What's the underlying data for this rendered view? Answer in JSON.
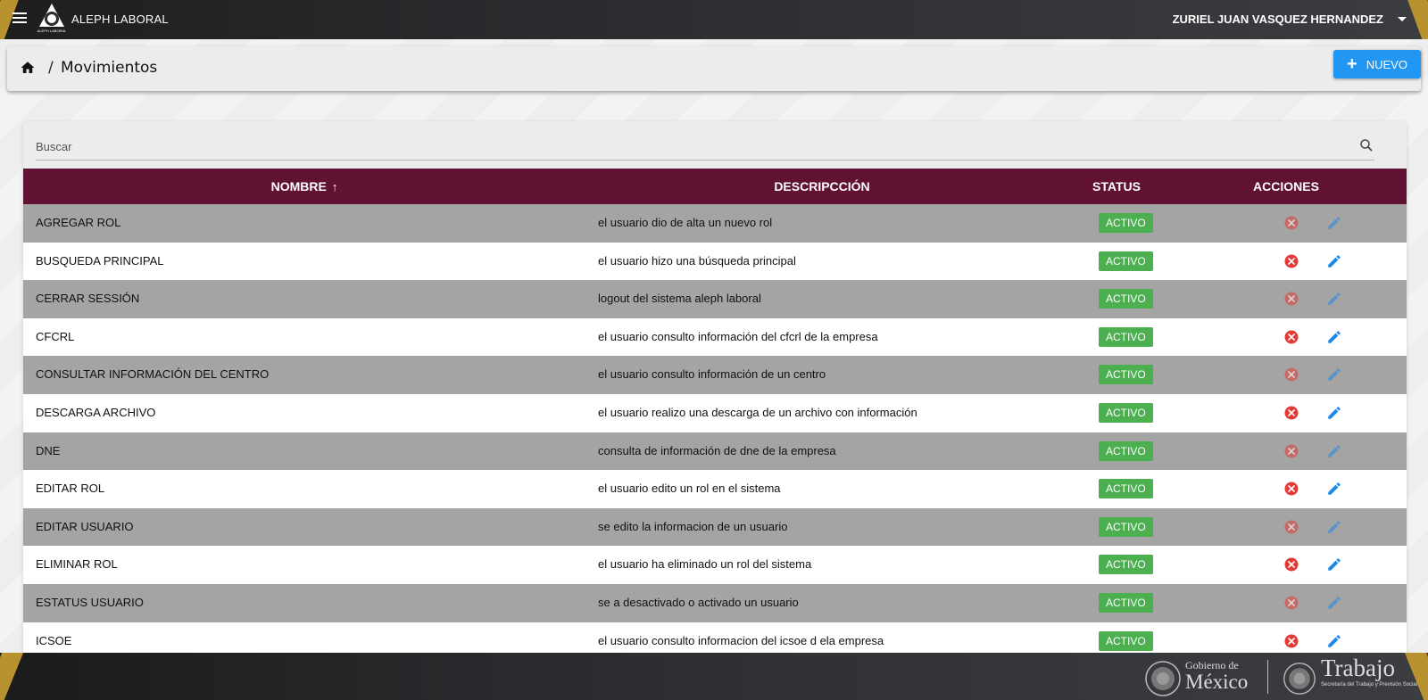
{
  "topbar": {
    "app_name": "ALEPH LABORAL",
    "logo_caption": "ALEPH LABORAL",
    "user_name": "ZURIEL JUAN VASQUEZ HERNANDEZ"
  },
  "breadcrumb": {
    "separator": "/",
    "title": "Movimientos",
    "new_button_label": "NUEVO"
  },
  "search": {
    "placeholder": "Buscar"
  },
  "table": {
    "headers": {
      "nombre": "NOMBRE",
      "sort_indicator": "↑",
      "descripcion": "DESCRIPCCIÓN",
      "status": "STATUS",
      "acciones": "ACCIONES"
    },
    "rows": [
      {
        "nombre": "AGREGAR ROL",
        "descripcion": "el usuario dio de alta un nuevo rol",
        "status": "ACTIVO"
      },
      {
        "nombre": "BUSQUEDA PRINCIPAL",
        "descripcion": "el usuario hizo una búsqueda principal",
        "status": "ACTIVO"
      },
      {
        "nombre": "CERRAR SESSIÓN",
        "descripcion": "logout del sistema aleph laboral",
        "status": "ACTIVO"
      },
      {
        "nombre": "CFCRL",
        "descripcion": "el usuario consulto información del cfcrl de la empresa",
        "status": "ACTIVO"
      },
      {
        "nombre": "CONSULTAR INFORMACIÓN DEL CENTRO",
        "descripcion": "el usuario consulto información de un centro",
        "status": "ACTIVO"
      },
      {
        "nombre": "DESCARGA ARCHIVO",
        "descripcion": "el usuario realizo una descarga de un archivo con información",
        "status": "ACTIVO"
      },
      {
        "nombre": "DNE",
        "descripcion": "consulta de información de dne de la empresa",
        "status": "ACTIVO"
      },
      {
        "nombre": "EDITAR ROL",
        "descripcion": "el usuario edito un rol en el sistema",
        "status": "ACTIVO"
      },
      {
        "nombre": "EDITAR USUARIO",
        "descripcion": "se edito la informacion de un usuario",
        "status": "ACTIVO"
      },
      {
        "nombre": "ELIMINAR ROL",
        "descripcion": "el usuario ha eliminado un rol del sistema",
        "status": "ACTIVO"
      },
      {
        "nombre": "ESTATUS USUARIO",
        "descripcion": "se a desactivado o activado un usuario",
        "status": "ACTIVO"
      },
      {
        "nombre": "ICSOE",
        "descripcion": "el usuario consulto informacion del icsoe d ela empresa",
        "status": "ACTIVO"
      }
    ]
  },
  "footer": {
    "gobierno_line1": "Gobierno de",
    "gobierno_line2": "México",
    "trabajo_line1": "Trabajo",
    "trabajo_line2": "Secretaría del Trabajo y Previsión Social"
  },
  "icons": {
    "menu": "menu-icon",
    "home": "home-icon",
    "add": "plus-icon",
    "search": "search-icon",
    "delete": "cancel-circle-icon",
    "edit": "pencil-icon",
    "user_caret": "caret-down-icon"
  },
  "colors": {
    "header_maroon": "#611232",
    "status_green": "#4caf50",
    "primary_blue": "#2196f3",
    "delete_red": "#e53935",
    "gold_accent": "#b8922e"
  }
}
